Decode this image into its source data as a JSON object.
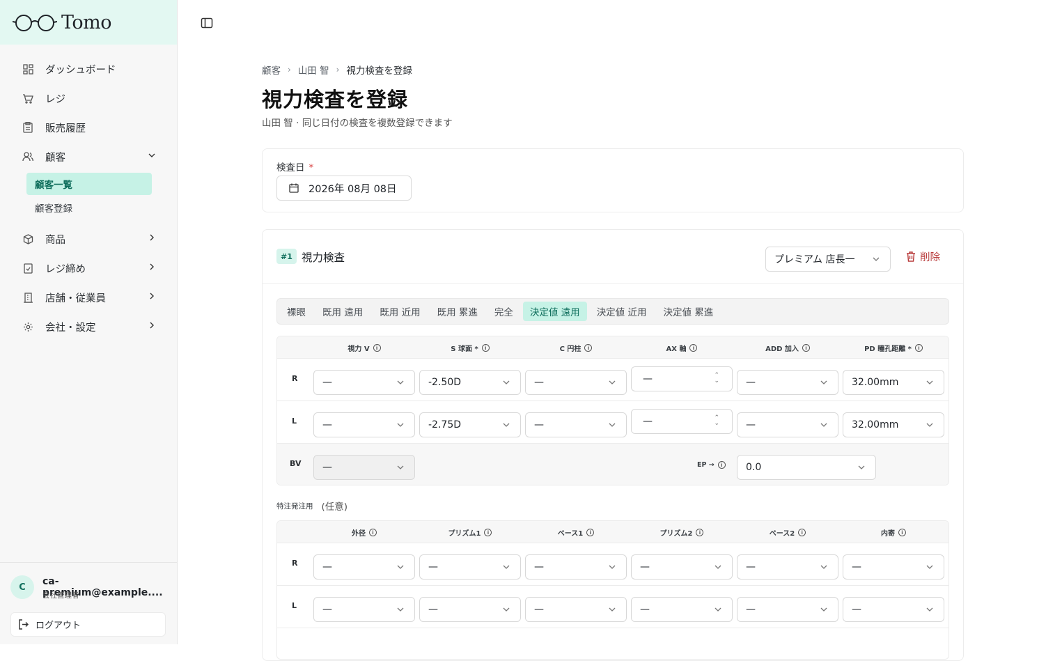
{
  "app": {
    "logo_text": "Tomo",
    "accent": "#0f6e5c",
    "active_bg": "#c6f2e6"
  },
  "sidebar": {
    "items": [
      {
        "label": "ダッシュボード",
        "icon": "grid-icon"
      },
      {
        "label": "レジ",
        "icon": "cart-icon"
      },
      {
        "label": "販売履歴",
        "icon": "clipboard-icon"
      },
      {
        "label": "顧客",
        "icon": "users-icon"
      },
      {
        "label": "商品",
        "icon": "package-icon"
      },
      {
        "label": "レジ締め",
        "icon": "receipt-icon"
      },
      {
        "label": "店舗・従業員",
        "icon": "building-icon"
      },
      {
        "label": "会社・設定",
        "icon": "gear-icon"
      }
    ],
    "sub_items": [
      {
        "label": "顧客一覧",
        "active": true
      },
      {
        "label": "顧客登録",
        "active": false
      }
    ],
    "user": {
      "avatar": "C",
      "email": "ca-premium@example....",
      "role": "会社管理者"
    },
    "logout": "ログアウト"
  },
  "breadcrumb": [
    "顧客",
    "山田 智",
    "視力検査を登録"
  ],
  "page": {
    "title": "視力検査を登録",
    "subtitle_name": "山田 智",
    "subtitle_note": "同じ日付の検査を複数登録できます"
  },
  "date_section": {
    "label": "検査日",
    "required_mark": "*",
    "value": "2026年 08月 08日"
  },
  "exam": {
    "badge": "#1",
    "title": "視力検査",
    "staff": "プレミアム 店長一",
    "delete_label": "削除",
    "tabs": [
      "裸眼",
      "既用 遠用",
      "既用 近用",
      "既用 累進",
      "完全",
      "決定値 遠用",
      "決定値 近用",
      "決定値 累進"
    ],
    "active_tab": 5,
    "grid1": {
      "headers": [
        "視力 V",
        "S 球面 *",
        "C 円柱",
        "AX 軸",
        "ADD 加入",
        "PD 瞳孔距離 *"
      ],
      "rows": [
        {
          "label": "R",
          "v": "—",
          "s": "-2.50D",
          "c": "—",
          "ax": "—",
          "add": "—",
          "pd": "32.00mm"
        },
        {
          "label": "L",
          "v": "—",
          "s": "-2.75D",
          "c": "—",
          "ax": "—",
          "add": "—",
          "pd": "32.00mm"
        }
      ],
      "bv": {
        "label": "BV",
        "value": "—",
        "ep_label": "EP →",
        "ep_value": "0.0"
      }
    },
    "special": {
      "label": "特注発注用",
      "optional": "(任意)"
    },
    "grid2": {
      "headers": [
        "外径",
        "プリズム1",
        "ベース1",
        "プリズム2",
        "ベース2",
        "内寄"
      ],
      "rows": [
        {
          "label": "R",
          "values": [
            "—",
            "—",
            "—",
            "—",
            "—",
            "—"
          ]
        },
        {
          "label": "L",
          "values": [
            "—",
            "—",
            "—",
            "—",
            "—",
            "—"
          ]
        }
      ]
    }
  }
}
